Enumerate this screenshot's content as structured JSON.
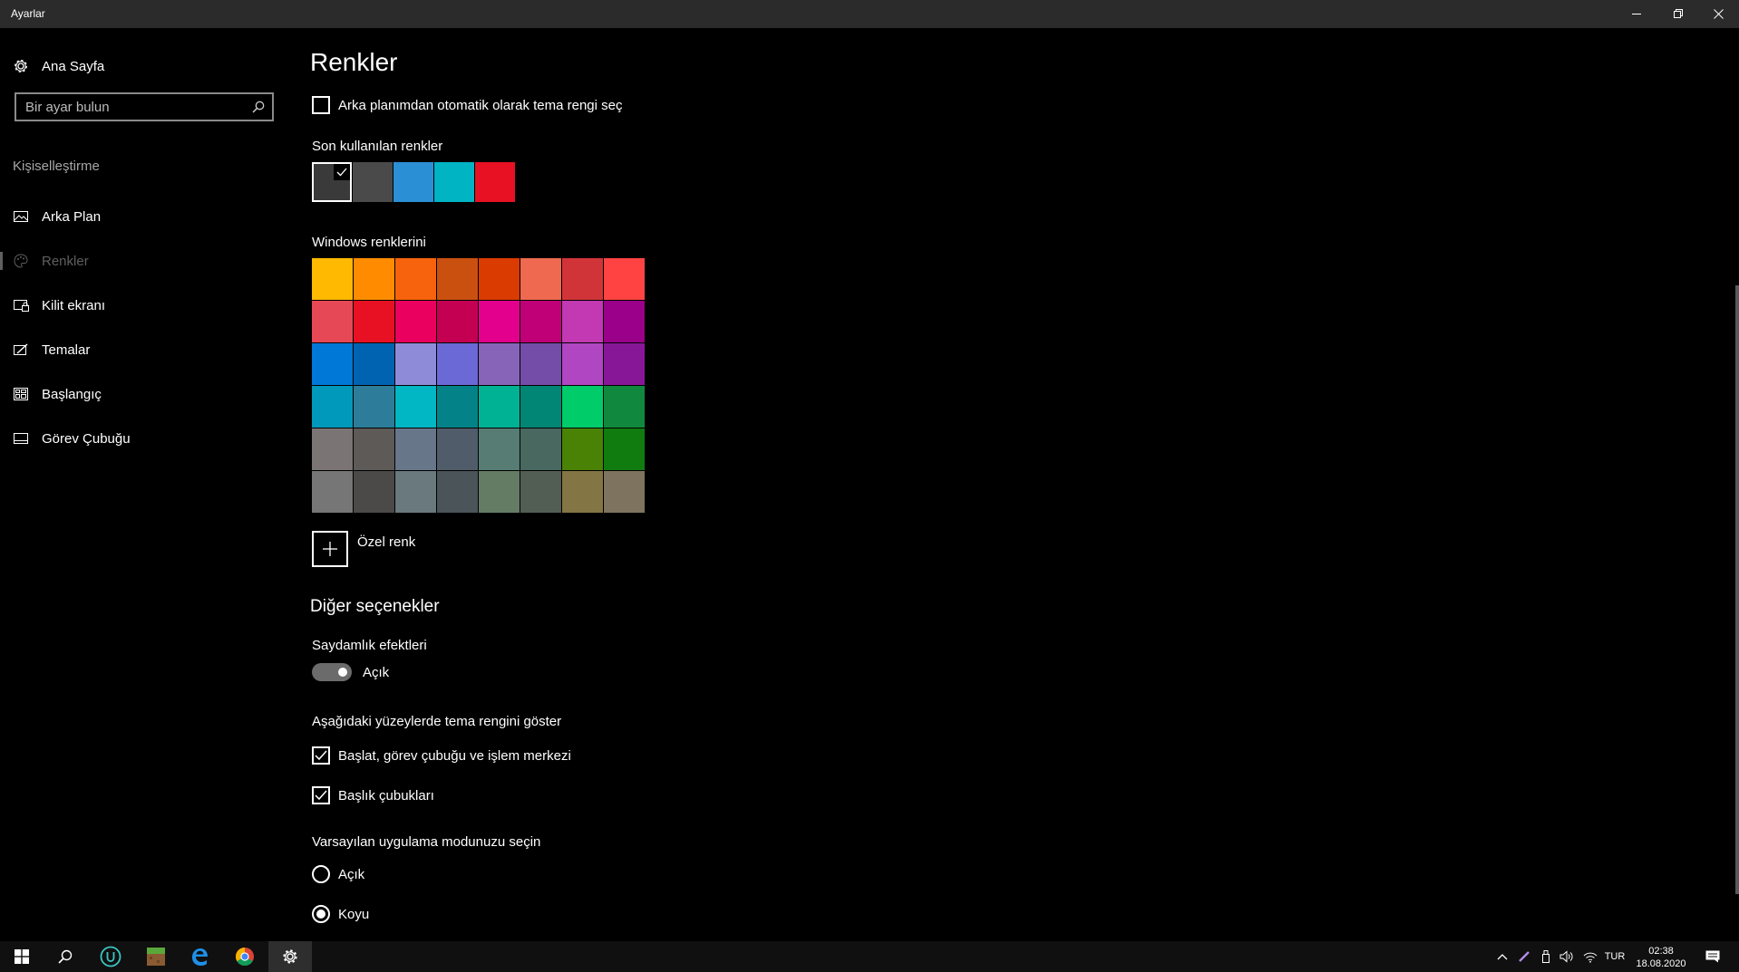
{
  "window": {
    "title": "Ayarlar"
  },
  "sidebar": {
    "home_label": "Ana Sayfa",
    "search_placeholder": "Bir ayar bulun",
    "category": "Kişiselleştirme",
    "items": [
      {
        "label": "Arka Plan",
        "icon": "picture-icon"
      },
      {
        "label": "Renkler",
        "icon": "palette-icon",
        "active": true
      },
      {
        "label": "Kilit ekranı",
        "icon": "lock-screen-icon"
      },
      {
        "label": "Temalar",
        "icon": "themes-icon"
      },
      {
        "label": "Başlangıç",
        "icon": "start-icon"
      },
      {
        "label": "Görev Çubuğu",
        "icon": "taskbar-icon"
      }
    ]
  },
  "main": {
    "title": "Renkler",
    "auto_accent_label": "Arka planımdan otomatik olarak tema rengi seç",
    "auto_accent_checked": false,
    "recent_label": "Son kullanılan renkler",
    "recent_colors": [
      "#3a3a3a",
      "#4a4a4a",
      "#2b8fd6",
      "#00b4c4",
      "#e81123"
    ],
    "recent_selected_index": 0,
    "windows_colors_label": "Windows renklerini",
    "windows_colors": [
      "#FFB900",
      "#FF8C00",
      "#F7630C",
      "#CA5010",
      "#DA3B01",
      "#EF6950",
      "#D13438",
      "#FF4343",
      "#E74856",
      "#E81123",
      "#EA005E",
      "#C30052",
      "#E3008C",
      "#BF0077",
      "#C239B3",
      "#9A0089",
      "#0078D7",
      "#0063B1",
      "#8E8CD8",
      "#6B69D6",
      "#8764B8",
      "#744DA9",
      "#B146C2",
      "#881798",
      "#0099BC",
      "#2D7D9A",
      "#00B7C3",
      "#038387",
      "#00B294",
      "#018574",
      "#00CC6A",
      "#10893E",
      "#7A7574",
      "#5D5A58",
      "#68768A",
      "#515C6B",
      "#567C73",
      "#486860",
      "#498205",
      "#107C10",
      "#767676",
      "#4C4A48",
      "#69797E",
      "#4A5459",
      "#647C64",
      "#525E54",
      "#847545",
      "#7E735F"
    ],
    "custom_color_label": "Özel renk",
    "other_options_title": "Diğer seçenekler",
    "transparency_label": "Saydamlık efektleri",
    "transparency_state": "Açık",
    "transparency_on": true,
    "surfaces_label": "Aşağıdaki yüzeylerde tema rengini göster",
    "surface_start_label": "Başlat, görev çubuğu ve işlem merkezi",
    "surface_start_checked": true,
    "surface_titlebars_label": "Başlık çubukları",
    "surface_titlebars_checked": true,
    "app_mode_label": "Varsayılan uygulama modunuzu seçin",
    "app_mode_light": "Açık",
    "app_mode_dark": "Koyu",
    "app_mode_selected": "Koyu"
  },
  "taskbar": {
    "language": "TUR",
    "time": "02:38",
    "date": "18.08.2020"
  }
}
